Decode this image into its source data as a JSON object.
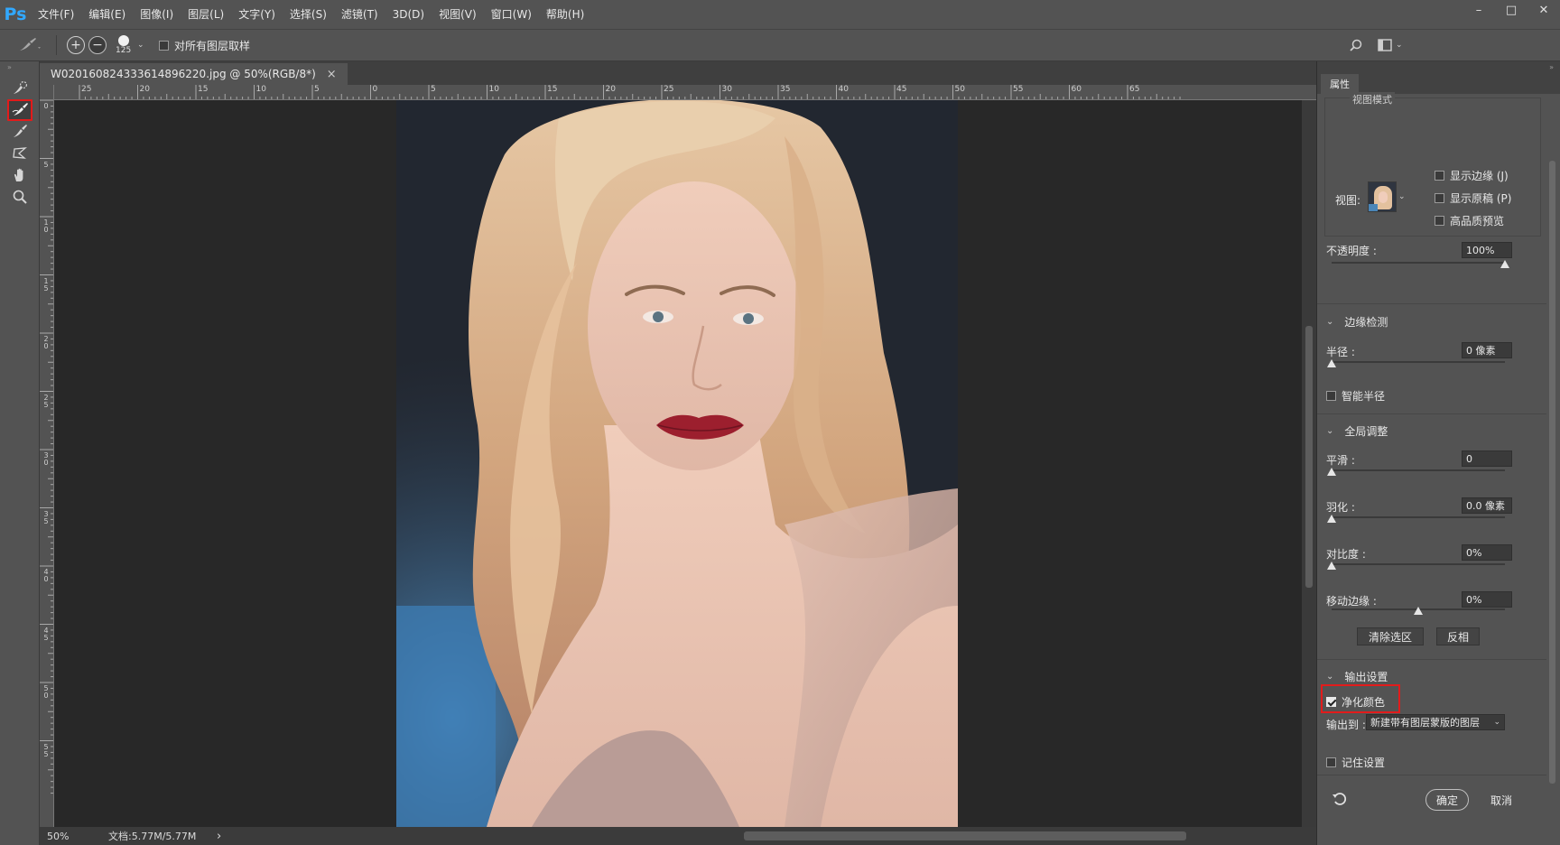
{
  "app": {
    "logo": "Ps"
  },
  "menu": [
    "文件(F)",
    "编辑(E)",
    "图像(I)",
    "图层(L)",
    "文字(Y)",
    "选择(S)",
    "滤镜(T)",
    "3D(D)",
    "视图(V)",
    "窗口(W)",
    "帮助(H)"
  ],
  "window_controls": {
    "minimize": "–",
    "restore": "□",
    "close": "✕"
  },
  "options": {
    "brush_size": "125",
    "sample_all_layers_label": "对所有图层取样",
    "sample_all_layers_checked": false
  },
  "document": {
    "tab_title": "W020160824333614896220.jpg @ 50%(RGB/8*)",
    "close_glyph": "×"
  },
  "ruler": {
    "h_labels": [
      "25",
      "20",
      "15",
      "10",
      "5",
      "0",
      "5",
      "10",
      "15",
      "20",
      "25",
      "30",
      "35",
      "40",
      "45",
      "50",
      "55",
      "60",
      "65"
    ],
    "v_labels": [
      "0",
      "5",
      "1 0",
      "1 5",
      "2 0",
      "2 5",
      "3 0",
      "3 5",
      "4 0",
      "4 5",
      "5 0",
      "5 5"
    ]
  },
  "status": {
    "zoom": "50%",
    "doc_size": "文档:5.77M/5.77M",
    "arrow": "›"
  },
  "panel": {
    "tab": "属性",
    "view_mode_label": "视图模式",
    "view_label": "视图:",
    "show_edge": {
      "label": "显示边缘 (J)",
      "checked": false
    },
    "show_original": {
      "label": "显示原稿 (P)",
      "checked": false
    },
    "high_quality": {
      "label": "高品质预览",
      "checked": false
    },
    "opacity": {
      "label": "不透明度 :",
      "value": "100%",
      "level": 1.0
    },
    "edge_detection": {
      "title": "边缘检测",
      "radius": {
        "label": "半径 :",
        "value": "0 像素",
        "level": 0.0
      },
      "smart_radius": {
        "label": "智能半径",
        "checked": false
      }
    },
    "global_refine": {
      "title": "全局调整",
      "smooth": {
        "label": "平滑 :",
        "value": "0",
        "level": 0.0
      },
      "feather": {
        "label": "羽化 :",
        "value": "0.0 像素",
        "level": 0.0
      },
      "contrast": {
        "label": "对比度 :",
        "value": "0%",
        "level": 0.0
      },
      "shift_edge": {
        "label": "移动边缘 :",
        "value": "0%",
        "level": 0.5
      },
      "clear_selection": "清除选区",
      "invert": "反相"
    },
    "output": {
      "title": "输出设置",
      "decontaminate": {
        "label": "净化颜色",
        "checked": true
      },
      "output_to_label": "输出到 :",
      "output_to_value": "新建带有图层蒙版的图层"
    },
    "remember": {
      "label": "记住设置",
      "checked": false
    },
    "ok": "确定",
    "cancel": "取消"
  }
}
